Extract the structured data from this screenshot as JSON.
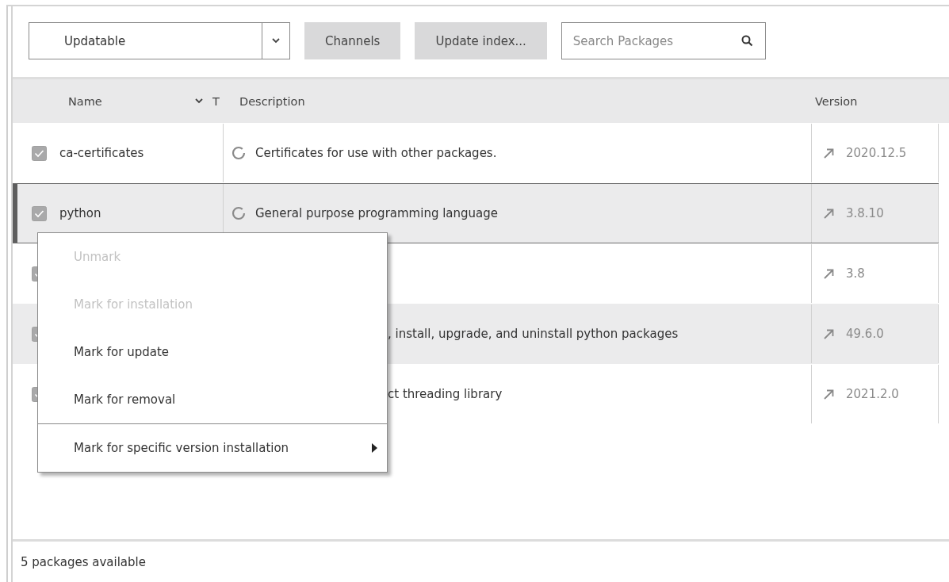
{
  "toolbar": {
    "filter": {
      "value": "Updatable"
    },
    "buttons": [
      "Channels",
      "Update index..."
    ],
    "search": {
      "placeholder": "Search Packages"
    }
  },
  "table": {
    "columns": [
      {
        "label": "Name",
        "sort": true
      },
      {
        "label": "T",
        "sort": false
      },
      {
        "label": "Description",
        "sort": false
      },
      {
        "label": "Version",
        "sort": false
      }
    ],
    "rows": [
      {
        "name": "ca-certificates",
        "checked": true,
        "selected": false,
        "loading": true,
        "description": "Certificates for use with other packages.",
        "version": "2020.12.5"
      },
      {
        "name": "python",
        "checked": true,
        "selected": true,
        "loading": true,
        "description": "General purpose programming language",
        "version": "3.8.10"
      },
      {
        "checked": true,
        "selected": false,
        "version": "3.8"
      },
      {
        "checked": true,
        "selected": false,
        "description": ", install, upgrade, and uninstall python packages",
        "version": "49.6.0"
      },
      {
        "checked": true,
        "selected": false,
        "description": "ct threading library",
        "version": "2021.2.0"
      }
    ]
  },
  "context_menu": {
    "items": [
      {
        "label": "Unmark",
        "disabled": true,
        "separator_before": false,
        "submenu": false
      },
      {
        "label": "Mark for installation",
        "disabled": true,
        "separator_before": false,
        "submenu": false
      },
      {
        "label": "Mark for update",
        "disabled": false,
        "separator_before": false,
        "submenu": false
      },
      {
        "label": "Mark for removal",
        "disabled": false,
        "separator_before": false,
        "submenu": false
      },
      {
        "label": "Mark for specific version installation",
        "disabled": false,
        "separator_before": true,
        "submenu": true
      }
    ]
  },
  "status_bar": {
    "text": "5 packages available"
  }
}
